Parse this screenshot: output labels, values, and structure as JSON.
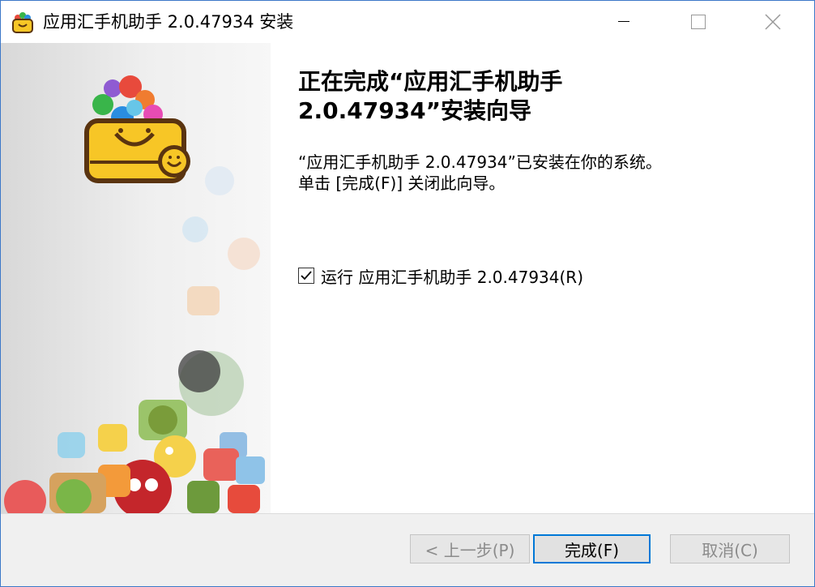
{
  "window": {
    "title": "应用汇手机助手 2.0.47934 安装",
    "controls": {
      "minimize_icon": "minimize-icon",
      "maximize_icon": "maximize-icon",
      "close_icon": "close-icon"
    }
  },
  "content": {
    "heading_line1": "正在完成“应用汇手机助手",
    "heading_line2": "2.0.47934”安装向导",
    "body_line1": "“应用汇手机助手 2.0.47934”已安装在你的系统。",
    "body_line2": "单击 [完成(F)] 关闭此向导。",
    "run_checkbox": {
      "label": "运行 应用汇手机助手 2.0.47934(R)",
      "checked": true
    }
  },
  "footer": {
    "back_label": "< 上一步(P)",
    "finish_label": "完成(F)",
    "cancel_label": "取消(C)"
  },
  "colors": {
    "accent": "#0078d7",
    "logo_yellow": "#f7c626",
    "logo_brown": "#5a3410"
  }
}
